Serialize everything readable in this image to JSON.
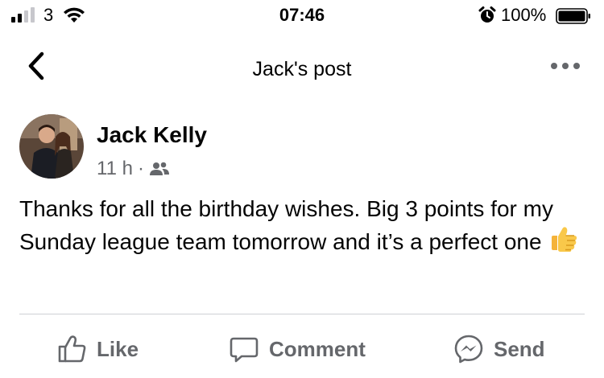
{
  "status_bar": {
    "carrier": "3",
    "time": "07:46",
    "battery_percent": "100%",
    "battery_level": 1.0,
    "signal_bars_active": 2,
    "signal_bars_total": 4,
    "icons": [
      "signal-icon",
      "wifi-icon",
      "alarm-icon",
      "battery-icon"
    ]
  },
  "nav": {
    "title": "Jack's post",
    "back_icon": "chevron-left-icon",
    "more_icon": "more-dots-icon"
  },
  "post": {
    "author": "Jack Kelly",
    "time_ago": "11 h",
    "separator": "·",
    "audience_icon": "friends-icon",
    "text": "Thanks for all the birthday wishes. Big 3 points for my Sunday league team tomorrow and it’s a perfect one",
    "emoji": "thumbs-up-emoji"
  },
  "actions": {
    "like_label": "Like",
    "comment_label": "Comment",
    "send_label": "Send"
  },
  "colors": {
    "text_primary": "#050505",
    "text_secondary": "#65676b",
    "divider": "#ced0d4",
    "signal_inactive": "#c7c7cc"
  }
}
